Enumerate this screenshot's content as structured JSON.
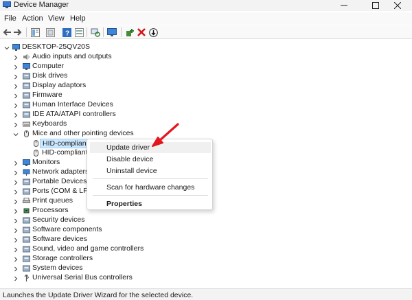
{
  "window": {
    "title": "Device Manager",
    "controls": [
      "minimize",
      "maximize",
      "close"
    ]
  },
  "menu": [
    "File",
    "Action",
    "View",
    "Help"
  ],
  "toolbar": {
    "icons": [
      "back-arrow-icon",
      "forward-arrow-icon",
      "properties-grid-icon",
      "show-hidden-icon",
      "help-icon",
      "action-list-icon",
      "scan-changes-icon",
      "monitor-icon",
      "add-driver-icon",
      "uninstall-x-icon",
      "download-circle-icon"
    ]
  },
  "tree": {
    "root": "DESKTOP-25QV20S",
    "categories": [
      {
        "label": "Audio inputs and outputs",
        "icon": "speaker-icon"
      },
      {
        "label": "Computer",
        "icon": "computer-icon"
      },
      {
        "label": "Disk drives",
        "icon": "disk-icon"
      },
      {
        "label": "Display adaptors",
        "icon": "display-adapter-icon"
      },
      {
        "label": "Firmware",
        "icon": "firmware-icon"
      },
      {
        "label": "Human Interface Devices",
        "icon": "hid-icon"
      },
      {
        "label": "IDE ATA/ATAPI controllers",
        "icon": "ide-icon"
      },
      {
        "label": "Keyboards",
        "icon": "keyboard-icon"
      },
      {
        "label": "Mice and other pointing devices",
        "icon": "mouse-icon",
        "expanded": true
      },
      {
        "label": "HID-compliant",
        "icon": "mouse-icon",
        "child": true,
        "selected": true
      },
      {
        "label": "HID-compliant",
        "icon": "mouse-icon",
        "child": true
      },
      {
        "label": "Monitors",
        "icon": "monitor-icon"
      },
      {
        "label": "Network adapters",
        "icon": "network-icon"
      },
      {
        "label": "Portable Devices",
        "icon": "portable-icon"
      },
      {
        "label": "Ports (COM & LPT)",
        "icon": "port-icon"
      },
      {
        "label": "Print queues",
        "icon": "printer-icon"
      },
      {
        "label": "Processors",
        "icon": "processor-icon"
      },
      {
        "label": "Security devices",
        "icon": "security-icon"
      },
      {
        "label": "Software components",
        "icon": "software-component-icon"
      },
      {
        "label": "Software devices",
        "icon": "software-device-icon"
      },
      {
        "label": "Sound, video and game controllers",
        "icon": "sound-icon"
      },
      {
        "label": "Storage controllers",
        "icon": "storage-icon"
      },
      {
        "label": "System devices",
        "icon": "system-icon"
      },
      {
        "label": "Universal Serial Bus controllers",
        "icon": "usb-icon"
      }
    ]
  },
  "context_menu": {
    "items": [
      {
        "label": "Update driver",
        "highlighted": true
      },
      {
        "label": "Disable device"
      },
      {
        "label": "Uninstall device"
      },
      {
        "separator": true
      },
      {
        "label": "Scan for hardware changes"
      },
      {
        "separator": true
      },
      {
        "label": "Properties",
        "bold": true
      }
    ]
  },
  "status": "Launches the Update Driver Wizard for the selected device.",
  "colors": {
    "accent": "#0067c0",
    "arrow": "#e3171d",
    "selection": "#cce8ff"
  }
}
